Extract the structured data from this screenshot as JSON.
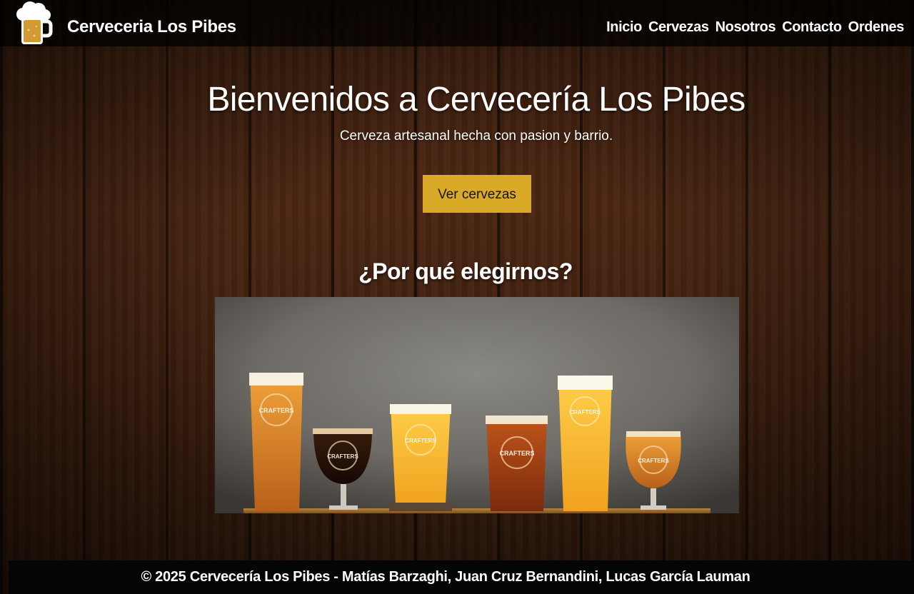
{
  "header": {
    "brand": "Cerveceria Los Pibes",
    "logo_icon": "beer-mug-icon",
    "nav": [
      {
        "label": "Inicio"
      },
      {
        "label": "Cervezas"
      },
      {
        "label": "Nosotros"
      },
      {
        "label": "Contacto"
      },
      {
        "label": "Ordenes"
      }
    ]
  },
  "hero": {
    "title": "Bienvenidos a Cervecería Los Pibes",
    "subtitle": "Cerveza artesanal hecha con pasion y barrio.",
    "cta_label": "Ver cervezas"
  },
  "why": {
    "title": "¿Por qué elegirnos?",
    "glass_label": "CRAFTERS"
  },
  "footer": {
    "text": "© 2025 Cervecería Los Pibes - Matías Barzaghi, Juan Cruz Bernandini, Lucas García Lauman"
  },
  "colors": {
    "accent": "#d9a928",
    "header_bg": "#000000",
    "text": "#ffffff"
  }
}
